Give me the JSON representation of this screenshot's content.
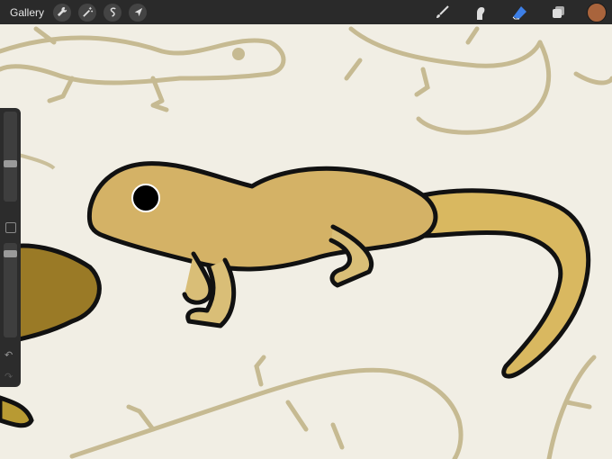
{
  "toolbar": {
    "gallery_label": "Gallery",
    "left_tools": [
      {
        "name": "actions",
        "icon": "wrench-icon"
      },
      {
        "name": "adjustments",
        "icon": "magic-wand-icon"
      },
      {
        "name": "selection",
        "icon": "selection-s-icon"
      },
      {
        "name": "transform",
        "icon": "arrow-cursor-icon"
      }
    ],
    "right_tools": [
      {
        "name": "brush",
        "icon": "brush-icon",
        "active": false
      },
      {
        "name": "smudge",
        "icon": "smudge-finger-icon",
        "active": false
      },
      {
        "name": "eraser",
        "icon": "eraser-icon",
        "active": true
      },
      {
        "name": "layers",
        "icon": "layers-icon",
        "active": false
      }
    ],
    "current_color": "#a9643c",
    "accent_color": "#3d7fe6"
  },
  "sidebar": {
    "brush_size_level": 0.5,
    "opacity_level": 0.95,
    "undo_icon": "undo-arrow-icon",
    "redo_icon": "redo-arrow-icon"
  },
  "canvas": {
    "background_color": "#f1eee4",
    "sketch_color": "#a49050",
    "gecko_body_color": "#d9b768"
  }
}
